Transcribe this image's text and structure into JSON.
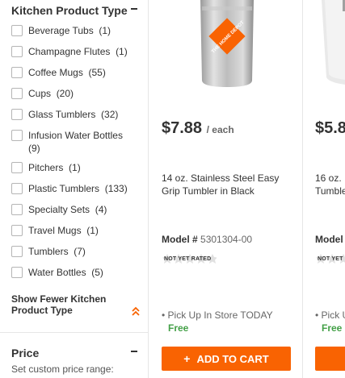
{
  "sidebar": {
    "filter_title": "Kitchen Product Type",
    "items": [
      {
        "label": "Beverage Tubs",
        "count": "(1)"
      },
      {
        "label": "Champagne Flutes",
        "count": "(1)"
      },
      {
        "label": "Coffee Mugs",
        "count": "(55)"
      },
      {
        "label": "Cups",
        "count": "(20)"
      },
      {
        "label": "Glass Tumblers",
        "count": "(32)"
      },
      {
        "label": "Infusion Water Bottles",
        "count": "(9)"
      },
      {
        "label": "Pitchers",
        "count": "(1)"
      },
      {
        "label": "Plastic Tumblers",
        "count": "(133)"
      },
      {
        "label": "Specialty Sets",
        "count": "(4)"
      },
      {
        "label": "Travel Mugs",
        "count": "(1)"
      },
      {
        "label": "Tumblers",
        "count": "(7)"
      },
      {
        "label": "Water Bottles",
        "count": "(5)"
      }
    ],
    "show_fewer_label": "Show Fewer Kitchen Product Type",
    "price_title": "Price",
    "price_subtitle": "Set custom price range:"
  },
  "products": [
    {
      "price": "$7.88",
      "price_unit": "/ each",
      "title": "14 oz. Stainless Steel Easy Grip Tumbler in Black",
      "model_label": "Model #",
      "model_number": "5301304-00",
      "rating_text": "NOT YET RATED",
      "pickup": "• Pick Up In Store TODAY",
      "free": "Free",
      "cart_label": "ADD TO CART",
      "logo_text": "THE HOME DEPOT"
    },
    {
      "price": "$5.8",
      "title": "16 oz.",
      "title_line2": "Tumble",
      "model_label": "Model",
      "rating_text": "NOT YET",
      "pickup": "• Pick U",
      "free": "Free"
    }
  ],
  "colors": {
    "accent": "#f96302",
    "free": "#43a047",
    "text": "#333333"
  }
}
